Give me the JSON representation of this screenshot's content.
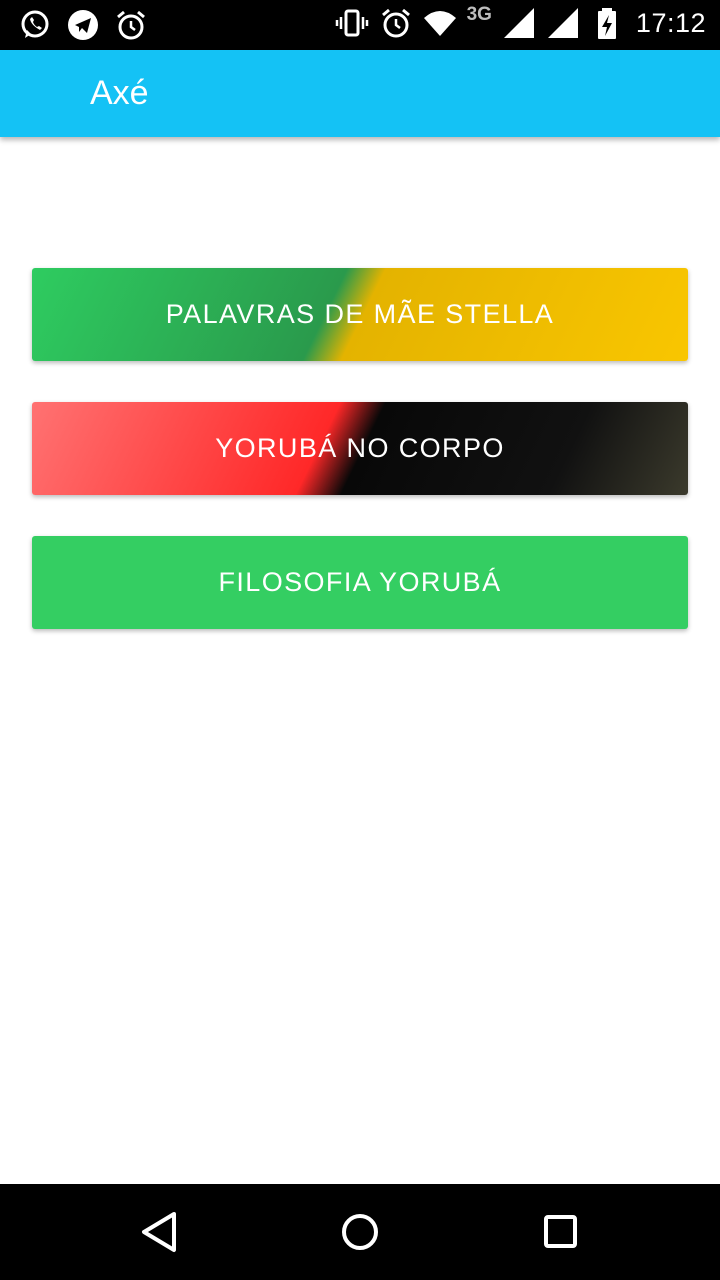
{
  "status_bar": {
    "left_icons": [
      "whatsapp-icon",
      "telegram-icon",
      "alarm-icon"
    ],
    "right_icons": [
      "vibrate-icon",
      "alarm-icon",
      "wifi-icon",
      "signal-icon",
      "signal-icon",
      "battery-charging-icon"
    ],
    "network_type": "3G",
    "time": "17:12"
  },
  "app_bar": {
    "title": "Axé",
    "color": "#14c2f5"
  },
  "buttons": [
    {
      "label": "PALAVRAS DE MÃE STELLA",
      "colors": [
        "#2ecc60",
        "#2a9a4c",
        "#e4b300",
        "#f9c600"
      ]
    },
    {
      "label": "YORUBÁ NO CORPO",
      "colors": [
        "#ff7272",
        "#ff2828",
        "#080808",
        "#3b3a2c"
      ]
    },
    {
      "label": "FILOSOFIA YORUBÁ",
      "colors": [
        "#34ce62"
      ]
    }
  ],
  "nav_bar": {
    "icons": [
      "back-icon",
      "home-icon",
      "recents-icon"
    ]
  }
}
